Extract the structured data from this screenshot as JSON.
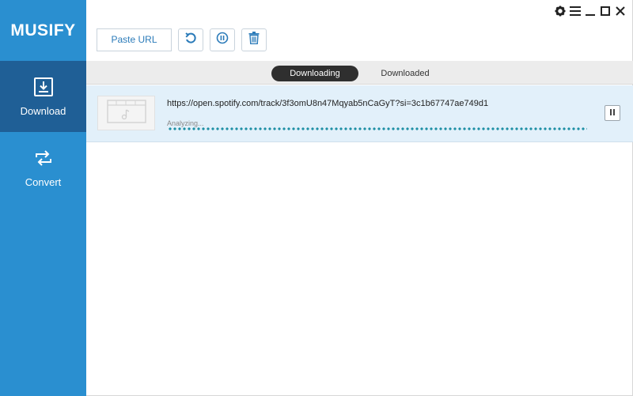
{
  "app": {
    "name": "MUSIFY"
  },
  "sidebar": {
    "items": [
      {
        "label": "Download",
        "icon": "download-icon",
        "active": true
      },
      {
        "label": "Convert",
        "icon": "convert-icon",
        "active": false
      }
    ]
  },
  "window_controls": [
    "gear-icon",
    "menu-icon",
    "minimize-icon",
    "maximize-icon",
    "close-icon"
  ],
  "toolbar": {
    "paste_label": "Paste URL",
    "buttons": [
      "refresh-icon",
      "pause-all-icon",
      "delete-icon"
    ]
  },
  "tabs": [
    {
      "label": "Downloading",
      "active": true
    },
    {
      "label": "Downloaded",
      "active": false
    }
  ],
  "downloads": [
    {
      "url": "https://open.spotify.com/track/3f3omU8n47Mqyab5nCaGyT?si=3c1b67747ae749d1",
      "status": "Analyzing..."
    }
  ],
  "colors": {
    "sidebar": "#2a8fd0",
    "sidebar_active": "#1f5f96",
    "accent": "#2b7bb9",
    "row_highlight": "#e2f0fa",
    "progress": "#1e8fa5"
  }
}
